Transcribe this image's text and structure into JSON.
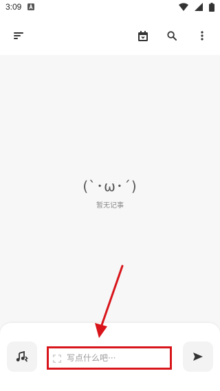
{
  "status_bar": {
    "time": "3:09"
  },
  "empty_state": {
    "kaomoji": "(`･ω･´)",
    "text": "暂无记事"
  },
  "composer": {
    "placeholder": "写点什么吧···"
  },
  "colors": {
    "annotation": "#d8151b",
    "background": "#f7f7f7"
  },
  "icons": [
    "menu-icon",
    "calendar-icon",
    "search-icon",
    "more-vert-icon",
    "music-icon",
    "expand-icon",
    "send-icon"
  ]
}
